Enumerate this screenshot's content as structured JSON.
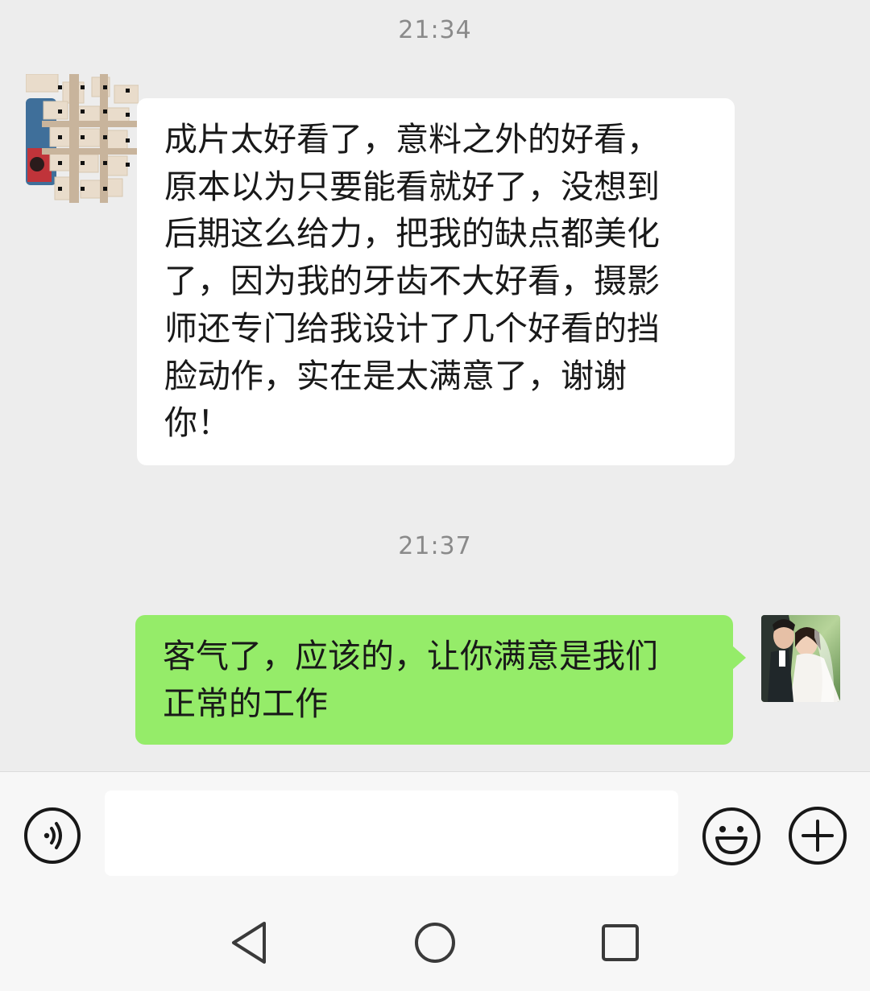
{
  "chat": {
    "messages": [
      {
        "time": "21:34",
        "direction": "incoming",
        "lines": [
          "成片太好看了，意料之外的好看，",
          "原本以为只要能看就好了，没想到",
          "后期这么给力，把我的缺点都美化",
          "了，因为我的牙齿不大好看，摄影",
          "师还专门给我设计了几个好看的挡",
          "脸动作，实在是太满意了，谢谢",
          "你！"
        ]
      },
      {
        "time": "21:37",
        "direction": "outgoing",
        "lines": [
          "客气了，应该的，让你满意是我们",
          "正常的工作"
        ]
      }
    ]
  },
  "input_bar": {
    "voice_icon": "voice-icon",
    "emoji_icon": "emoji-icon",
    "plus_icon": "plus-icon",
    "message_value": ""
  },
  "nav_bar": {
    "back_icon": "back-triangle-icon",
    "home_icon": "home-circle-icon",
    "recents_icon": "recents-square-icon"
  },
  "colors": {
    "chat_background": "#ededed",
    "incoming_bubble": "#ffffff",
    "outgoing_bubble": "#95ec69",
    "timestamp_text": "#8a8a8a",
    "icon_stroke": "#181818"
  }
}
